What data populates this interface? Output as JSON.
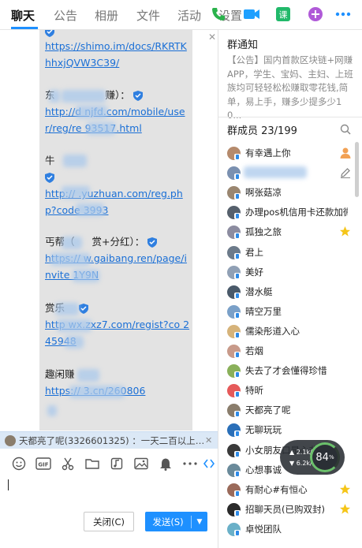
{
  "tabs": [
    {
      "label": "聊天",
      "active": true
    },
    {
      "label": "公告"
    },
    {
      "label": "相册"
    },
    {
      "label": "文件"
    },
    {
      "label": "活动"
    },
    {
      "label": "设置"
    }
  ],
  "top_icons": [
    "phone-call-icon",
    "video-call-icon",
    "classroom-icon",
    "add-app-icon",
    "more-icon"
  ],
  "chat": {
    "blocks": [
      {
        "links": [
          "https://shimo.im/docs/RKRTKhhxjQVW3C39/"
        ]
      },
      {
        "title_prefix": "东",
        "title_suffix": "赚）：",
        "link": "http://d   njfd.com/mobile/user/reg/re   93517.html"
      },
      {
        "title_prefix": "牛",
        "link": "http://   .yuzhuan.com/reg.php?code   3993"
      },
      {
        "title_prefix": "丐帮（",
        "title_suffix": "赏+分红）：",
        "link": "https://   w.gaibang.ren/page/invite   1Y9N"
      },
      {
        "title_prefix": "赏乐",
        "link": "http   wx.zxz7.com/regist?co   245948"
      },
      {
        "title_prefix": "趣闲赚",
        "link": "https://   3.cn/260806"
      }
    ]
  },
  "reply_strip": {
    "text": "天都亮了呢(3326601325) ：一天二百以上,男生..."
  },
  "toolbar": [
    "emoji-icon",
    "gif-icon",
    "scissors-icon",
    "folder-icon",
    "music-icon",
    "image-icon",
    "bell-icon",
    "more-dots-icon",
    "collapse-arrows-icon"
  ],
  "buttons": {
    "close": "关闭(C)",
    "send": "发送(S)"
  },
  "notice": {
    "title": "群通知",
    "text": "【公告】国内首款区块链+网赚APP，学生、宝妈、主妇、上班族均可轻轻松松赚取零花钱,简单，易上手，赚多少提多少10..."
  },
  "members": {
    "header": "群成员 23/199",
    "list": [
      {
        "name": "有幸遇上你",
        "color": "#b58a6c",
        "role": "owner"
      },
      {
        "name": "",
        "color": "#7a90b0"
      },
      {
        "name": "啊张菇凉",
        "color": "#9a8670"
      },
      {
        "name": "办理pos机信用卡还款加微信",
        "color": "#56606c"
      },
      {
        "name": "孤独之旅",
        "color": "#8c8ca0",
        "star": true
      },
      {
        "name": "君上",
        "color": "#6c7a8a"
      },
      {
        "name": "美好",
        "color": "#90a0b5"
      },
      {
        "name": "潜水艇",
        "color": "#4a5a6a"
      },
      {
        "name": "晴空万里",
        "color": "#7aa0c8"
      },
      {
        "name": "儒染彤道入心",
        "color": "#d6b37a"
      },
      {
        "name": "若烟",
        "color": "#c89a8a"
      },
      {
        "name": "失去了才会懂得珍惜",
        "color": "#8ab05a"
      },
      {
        "name": "特昕",
        "color": "#e65a5a"
      },
      {
        "name": "天都亮了呢",
        "color": "#8a7d6c"
      },
      {
        "name": "无聊玩玩",
        "color": "#2a6fb8"
      },
      {
        "name": "小女朋友口是心非",
        "color": "#3a3a3a"
      },
      {
        "name": "心想事诚",
        "color": "#6a8a9a"
      },
      {
        "name": "有耐心#有恒心",
        "color": "#9a6a5a",
        "star": true
      },
      {
        "name": "招聊天员(已购双封)",
        "color": "#2a2a2a",
        "star": true
      },
      {
        "name": "卓悦团队",
        "color": "#6ab0c8"
      }
    ]
  },
  "speed_widget": {
    "up": "2.1k/s",
    "down": "6.2k/s",
    "percent": "84",
    "unit": "%"
  }
}
